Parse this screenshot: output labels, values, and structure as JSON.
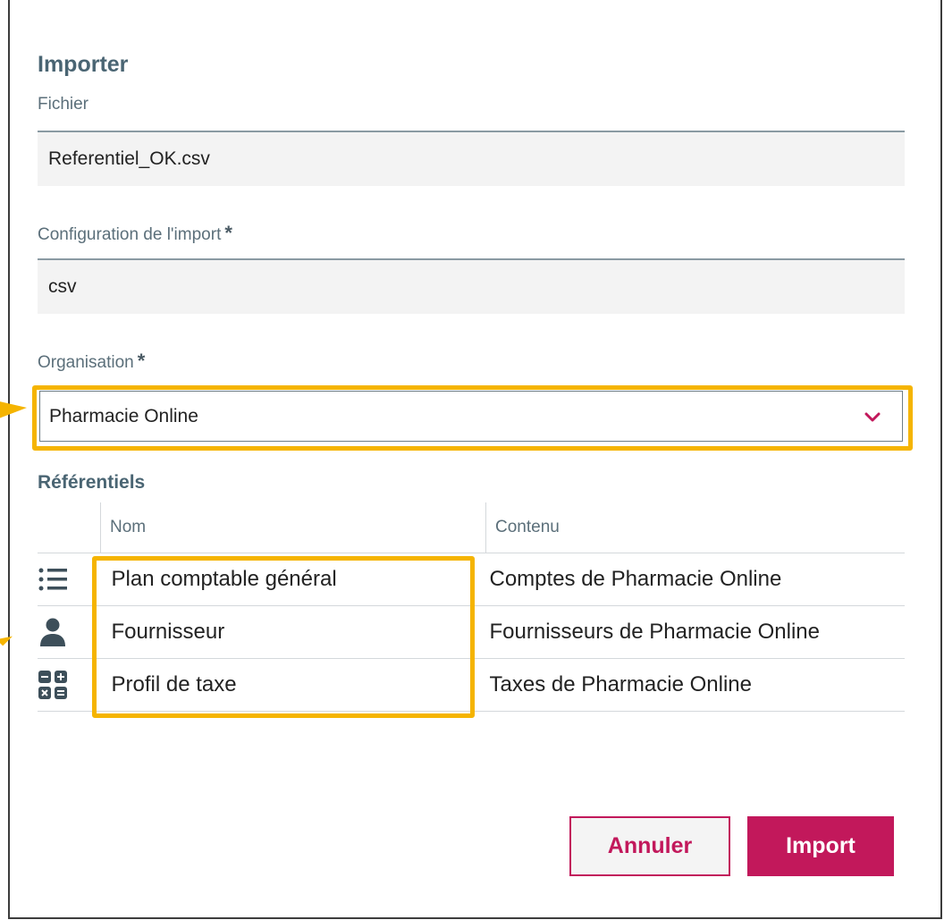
{
  "dialog": {
    "title": "Importer"
  },
  "file": {
    "label": "Fichier",
    "value": "Referentiel_OK.csv"
  },
  "config": {
    "label": "Configuration de l'import",
    "required": "*",
    "value": "csv"
  },
  "organisation": {
    "label": "Organisation",
    "required": "*",
    "value": "Pharmacie Online",
    "icon": "chevron-down-icon"
  },
  "referentiels": {
    "title": "Référentiels",
    "columns": [
      "",
      "Nom",
      "Contenu"
    ],
    "rows": [
      {
        "icon": "list-icon",
        "nom": "Plan comptable général",
        "contenu": "Comptes de Pharmacie Online"
      },
      {
        "icon": "person-icon",
        "nom": "Fournisseur",
        "contenu": "Fournisseurs de Pharmacie Online"
      },
      {
        "icon": "calculator-icon",
        "nom": "Profil de taxe",
        "contenu": "Taxes de Pharmacie Online"
      }
    ]
  },
  "buttons": {
    "cancel": "Annuler",
    "import": "Import"
  },
  "colors": {
    "accent": "#c2185b",
    "highlight": "#f5b400",
    "heading": "#4a6573"
  }
}
